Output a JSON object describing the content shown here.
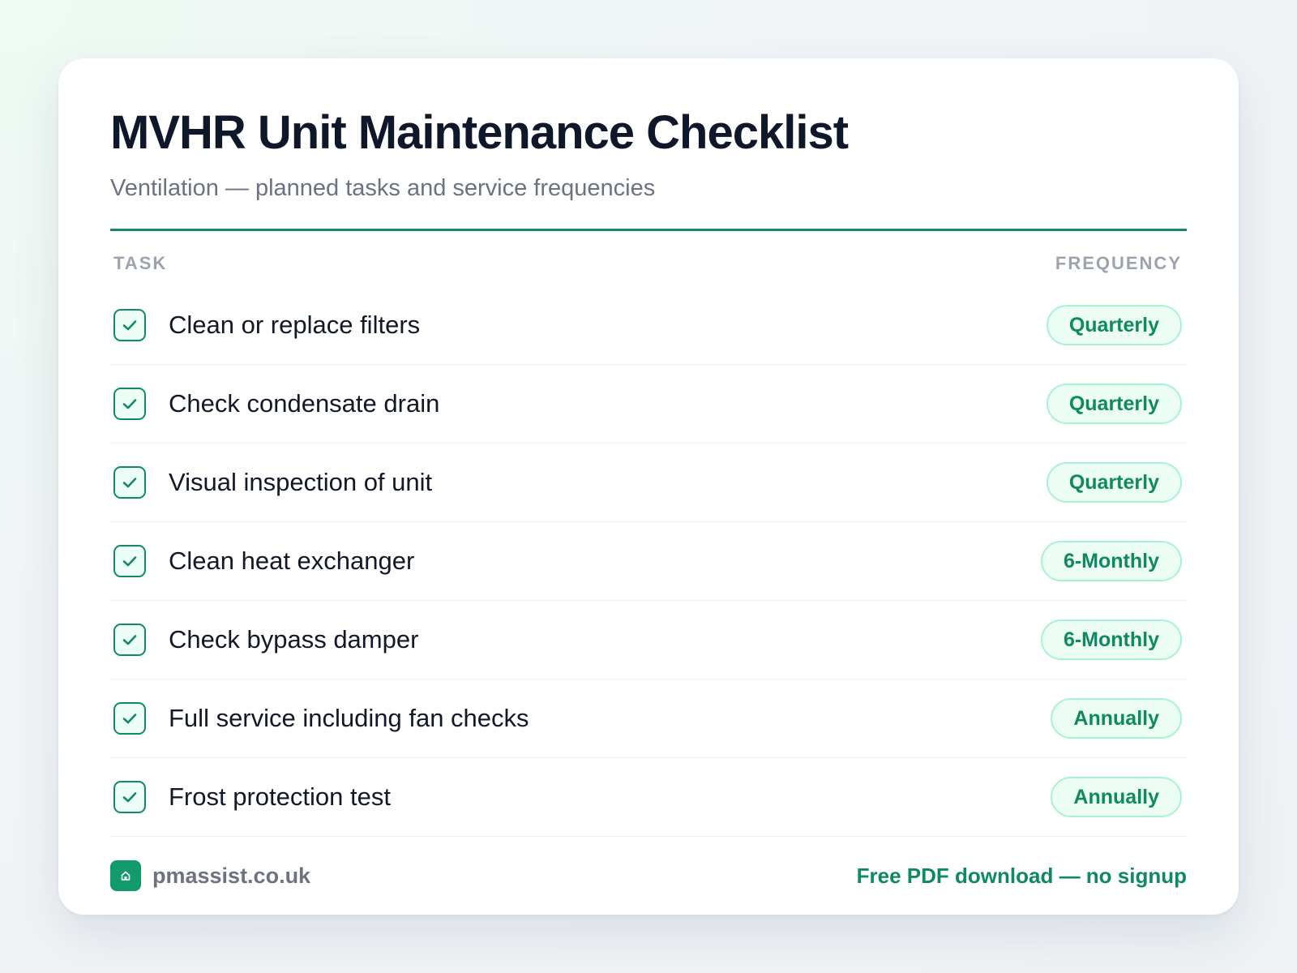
{
  "header": {
    "title": "MVHR Unit Maintenance Checklist",
    "subtitle": "Ventilation — planned tasks and service frequencies"
  },
  "table": {
    "columns": {
      "task": "TASK",
      "frequency": "FREQUENCY"
    },
    "rows": [
      {
        "task": "Clean or replace filters",
        "frequency": "Quarterly",
        "checked": true
      },
      {
        "task": "Check condensate drain",
        "frequency": "Quarterly",
        "checked": true
      },
      {
        "task": "Visual inspection of unit",
        "frequency": "Quarterly",
        "checked": true
      },
      {
        "task": "Clean heat exchanger",
        "frequency": "6-Monthly",
        "checked": true
      },
      {
        "task": "Check bypass damper",
        "frequency": "6-Monthly",
        "checked": true
      },
      {
        "task": "Full service including fan checks",
        "frequency": "Annually",
        "checked": true
      },
      {
        "task": "Frost protection test",
        "frequency": "Annually",
        "checked": true
      }
    ]
  },
  "footer": {
    "brand": "pmassist.co.uk",
    "brand_icon": "house-icon",
    "cta": "Free PDF download — no signup"
  },
  "colors": {
    "accent": "#128a62",
    "pill_background": "#ecfdf5",
    "pill_border": "#a7f3d0",
    "title": "#0f172a",
    "muted": "#6b7280"
  }
}
